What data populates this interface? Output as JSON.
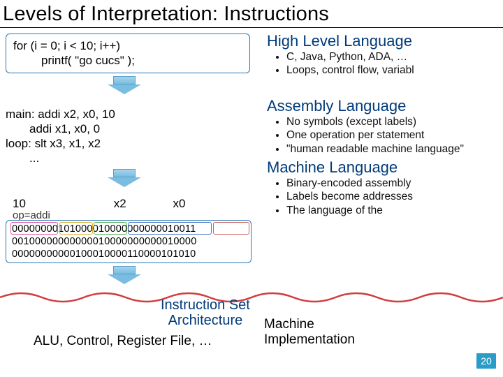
{
  "title": "Levels of Interpretation: Instructions",
  "hll": {
    "code1": "for (i = 0; i < 10; i++)",
    "code2": "printf( \"go cucs\" );",
    "heading": "High Level Language",
    "bullets": [
      "C, Java, Python, ADA, …",
      "Loops, control flow, variabl"
    ]
  },
  "asm": {
    "l1": "main:  addi x2, x0, 10",
    "l2": "addi x1, x0, 0",
    "l3": "loop:  slt x3, x1, x2",
    "l4": "...",
    "heading": "Assembly Language",
    "bullets": [
      "No symbols (except labels)",
      "One operation per statement",
      "\"human readable machine language\""
    ]
  },
  "ml": {
    "lab10": "10",
    "labx2": "x2",
    "labx0": "x0",
    "opaddi": "op=addi",
    "bin1": "00000000101000010000000000010011",
    "bin2": "00100000000000010000000000010000",
    "bin3": "00000000000100010000110000101010",
    "heading": "Machine Language",
    "bullets": [
      "Binary-encoded assembly",
      "Labels become addresses",
      "The language of the"
    ]
  },
  "isa": {
    "l1": "Instruction Set",
    "l2": "Architecture"
  },
  "impl": {
    "left": "ALU, Control, Register File, …",
    "r1": "Machine",
    "r2": "Implementation"
  },
  "pagenum": "20"
}
